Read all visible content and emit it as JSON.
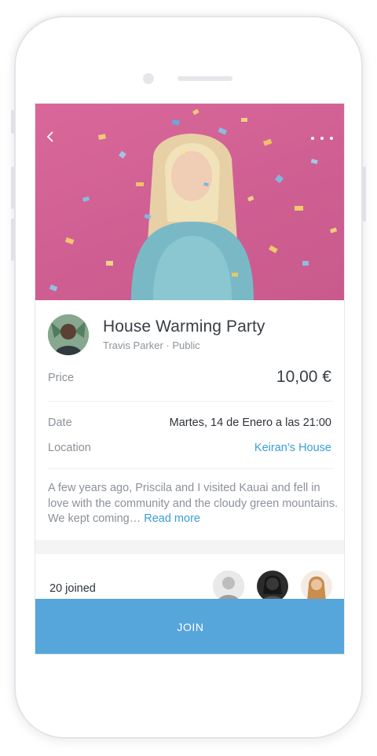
{
  "event": {
    "title": "House Warming Party",
    "host_line": "Travis Parker · Public"
  },
  "details": {
    "price_label": "Price",
    "price_value": "10,00 €",
    "date_label": "Date",
    "date_value": "Martes, 14 de Enero a las 21:00",
    "location_label": "Location",
    "location_value": "Keiran’s House"
  },
  "description": {
    "text": "A few years ago, Priscila and I visited Kauai and fell in love with the community and the cloudy green mountains. We kept coming…",
    "read_more": "Read more"
  },
  "attendance": {
    "joined_text": "20 joined"
  },
  "actions": {
    "join_label": "JOIN"
  },
  "icons": {
    "back": "back-chevron-icon",
    "more": "more-horizontal-icon"
  },
  "colors": {
    "accent": "#56a5db",
    "link": "#3a9ed6",
    "hero_background": "#d9679a"
  }
}
